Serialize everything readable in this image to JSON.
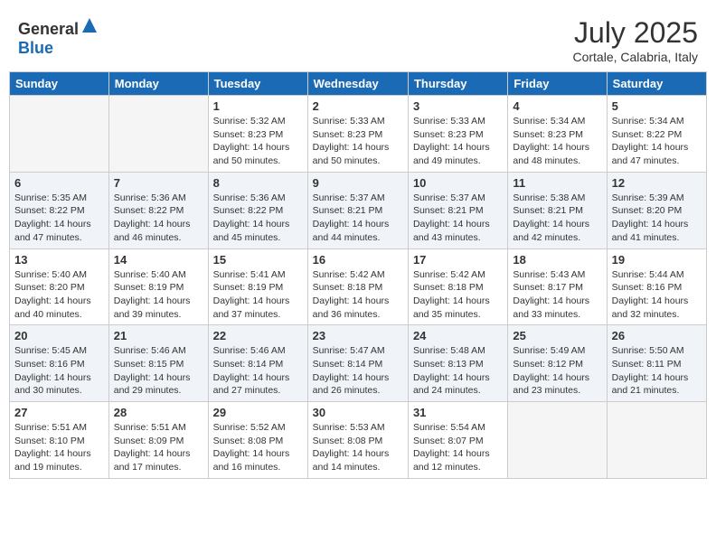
{
  "logo": {
    "text_general": "General",
    "text_blue": "Blue"
  },
  "header": {
    "month": "July 2025",
    "location": "Cortale, Calabria, Italy"
  },
  "weekdays": [
    "Sunday",
    "Monday",
    "Tuesday",
    "Wednesday",
    "Thursday",
    "Friday",
    "Saturday"
  ],
  "weeks": [
    [
      {
        "day": "",
        "sunrise": "",
        "sunset": "",
        "daylight": ""
      },
      {
        "day": "",
        "sunrise": "",
        "sunset": "",
        "daylight": ""
      },
      {
        "day": "1",
        "sunrise": "Sunrise: 5:32 AM",
        "sunset": "Sunset: 8:23 PM",
        "daylight": "Daylight: 14 hours and 50 minutes."
      },
      {
        "day": "2",
        "sunrise": "Sunrise: 5:33 AM",
        "sunset": "Sunset: 8:23 PM",
        "daylight": "Daylight: 14 hours and 50 minutes."
      },
      {
        "day": "3",
        "sunrise": "Sunrise: 5:33 AM",
        "sunset": "Sunset: 8:23 PM",
        "daylight": "Daylight: 14 hours and 49 minutes."
      },
      {
        "day": "4",
        "sunrise": "Sunrise: 5:34 AM",
        "sunset": "Sunset: 8:23 PM",
        "daylight": "Daylight: 14 hours and 48 minutes."
      },
      {
        "day": "5",
        "sunrise": "Sunrise: 5:34 AM",
        "sunset": "Sunset: 8:22 PM",
        "daylight": "Daylight: 14 hours and 47 minutes."
      }
    ],
    [
      {
        "day": "6",
        "sunrise": "Sunrise: 5:35 AM",
        "sunset": "Sunset: 8:22 PM",
        "daylight": "Daylight: 14 hours and 47 minutes."
      },
      {
        "day": "7",
        "sunrise": "Sunrise: 5:36 AM",
        "sunset": "Sunset: 8:22 PM",
        "daylight": "Daylight: 14 hours and 46 minutes."
      },
      {
        "day": "8",
        "sunrise": "Sunrise: 5:36 AM",
        "sunset": "Sunset: 8:22 PM",
        "daylight": "Daylight: 14 hours and 45 minutes."
      },
      {
        "day": "9",
        "sunrise": "Sunrise: 5:37 AM",
        "sunset": "Sunset: 8:21 PM",
        "daylight": "Daylight: 14 hours and 44 minutes."
      },
      {
        "day": "10",
        "sunrise": "Sunrise: 5:37 AM",
        "sunset": "Sunset: 8:21 PM",
        "daylight": "Daylight: 14 hours and 43 minutes."
      },
      {
        "day": "11",
        "sunrise": "Sunrise: 5:38 AM",
        "sunset": "Sunset: 8:21 PM",
        "daylight": "Daylight: 14 hours and 42 minutes."
      },
      {
        "day": "12",
        "sunrise": "Sunrise: 5:39 AM",
        "sunset": "Sunset: 8:20 PM",
        "daylight": "Daylight: 14 hours and 41 minutes."
      }
    ],
    [
      {
        "day": "13",
        "sunrise": "Sunrise: 5:40 AM",
        "sunset": "Sunset: 8:20 PM",
        "daylight": "Daylight: 14 hours and 40 minutes."
      },
      {
        "day": "14",
        "sunrise": "Sunrise: 5:40 AM",
        "sunset": "Sunset: 8:19 PM",
        "daylight": "Daylight: 14 hours and 39 minutes."
      },
      {
        "day": "15",
        "sunrise": "Sunrise: 5:41 AM",
        "sunset": "Sunset: 8:19 PM",
        "daylight": "Daylight: 14 hours and 37 minutes."
      },
      {
        "day": "16",
        "sunrise": "Sunrise: 5:42 AM",
        "sunset": "Sunset: 8:18 PM",
        "daylight": "Daylight: 14 hours and 36 minutes."
      },
      {
        "day": "17",
        "sunrise": "Sunrise: 5:42 AM",
        "sunset": "Sunset: 8:18 PM",
        "daylight": "Daylight: 14 hours and 35 minutes."
      },
      {
        "day": "18",
        "sunrise": "Sunrise: 5:43 AM",
        "sunset": "Sunset: 8:17 PM",
        "daylight": "Daylight: 14 hours and 33 minutes."
      },
      {
        "day": "19",
        "sunrise": "Sunrise: 5:44 AM",
        "sunset": "Sunset: 8:16 PM",
        "daylight": "Daylight: 14 hours and 32 minutes."
      }
    ],
    [
      {
        "day": "20",
        "sunrise": "Sunrise: 5:45 AM",
        "sunset": "Sunset: 8:16 PM",
        "daylight": "Daylight: 14 hours and 30 minutes."
      },
      {
        "day": "21",
        "sunrise": "Sunrise: 5:46 AM",
        "sunset": "Sunset: 8:15 PM",
        "daylight": "Daylight: 14 hours and 29 minutes."
      },
      {
        "day": "22",
        "sunrise": "Sunrise: 5:46 AM",
        "sunset": "Sunset: 8:14 PM",
        "daylight": "Daylight: 14 hours and 27 minutes."
      },
      {
        "day": "23",
        "sunrise": "Sunrise: 5:47 AM",
        "sunset": "Sunset: 8:14 PM",
        "daylight": "Daylight: 14 hours and 26 minutes."
      },
      {
        "day": "24",
        "sunrise": "Sunrise: 5:48 AM",
        "sunset": "Sunset: 8:13 PM",
        "daylight": "Daylight: 14 hours and 24 minutes."
      },
      {
        "day": "25",
        "sunrise": "Sunrise: 5:49 AM",
        "sunset": "Sunset: 8:12 PM",
        "daylight": "Daylight: 14 hours and 23 minutes."
      },
      {
        "day": "26",
        "sunrise": "Sunrise: 5:50 AM",
        "sunset": "Sunset: 8:11 PM",
        "daylight": "Daylight: 14 hours and 21 minutes."
      }
    ],
    [
      {
        "day": "27",
        "sunrise": "Sunrise: 5:51 AM",
        "sunset": "Sunset: 8:10 PM",
        "daylight": "Daylight: 14 hours and 19 minutes."
      },
      {
        "day": "28",
        "sunrise": "Sunrise: 5:51 AM",
        "sunset": "Sunset: 8:09 PM",
        "daylight": "Daylight: 14 hours and 17 minutes."
      },
      {
        "day": "29",
        "sunrise": "Sunrise: 5:52 AM",
        "sunset": "Sunset: 8:08 PM",
        "daylight": "Daylight: 14 hours and 16 minutes."
      },
      {
        "day": "30",
        "sunrise": "Sunrise: 5:53 AM",
        "sunset": "Sunset: 8:08 PM",
        "daylight": "Daylight: 14 hours and 14 minutes."
      },
      {
        "day": "31",
        "sunrise": "Sunrise: 5:54 AM",
        "sunset": "Sunset: 8:07 PM",
        "daylight": "Daylight: 14 hours and 12 minutes."
      },
      {
        "day": "",
        "sunrise": "",
        "sunset": "",
        "daylight": ""
      },
      {
        "day": "",
        "sunrise": "",
        "sunset": "",
        "daylight": ""
      }
    ]
  ]
}
